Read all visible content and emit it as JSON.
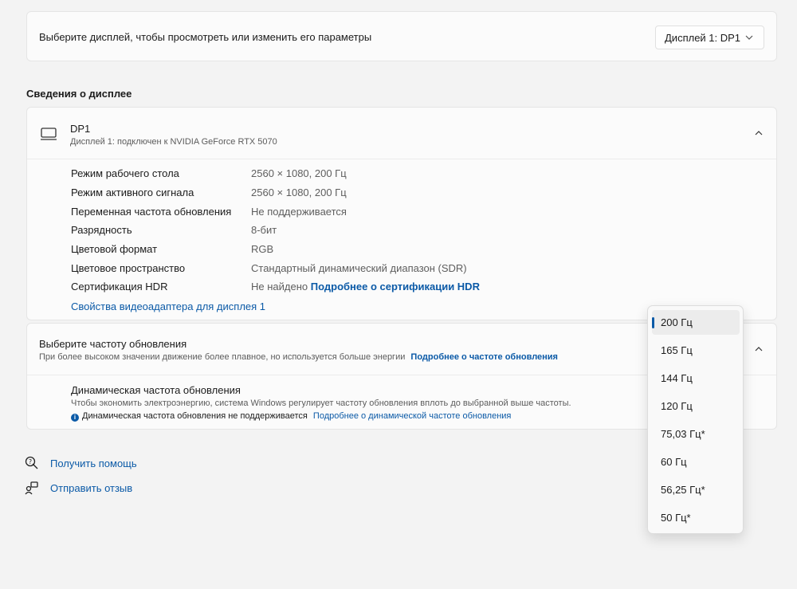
{
  "display_select": {
    "label": "Выберите дисплей, чтобы просмотреть или изменить его параметры",
    "value": "Дисплей 1: DP1"
  },
  "section_title": "Сведения о дисплее",
  "display_info": {
    "name": "DP1",
    "subtitle": "Дисплей 1: подключен к NVIDIA GeForce RTX 5070",
    "properties": [
      {
        "label": "Режим рабочего стола",
        "value": "2560 × 1080, 200 Гц"
      },
      {
        "label": "Режим активного сигнала",
        "value": "2560 × 1080, 200 Гц"
      },
      {
        "label": "Переменная частота обновления",
        "value": "Не поддерживается"
      },
      {
        "label": "Разрядность",
        "value": "8-бит"
      },
      {
        "label": "Цветовой формат",
        "value": "RGB"
      },
      {
        "label": "Цветовое пространство",
        "value": "Стандартный динамический диапазон (SDR)"
      },
      {
        "label": "Сертификация HDR",
        "value": "Не найдено",
        "link": "Подробнее о сертификации HDR"
      }
    ],
    "adapter_link": "Свойства видеоадаптера для дисплея 1"
  },
  "refresh_rate": {
    "title": "Выберите частоту обновления",
    "description": "При более высоком значении движение более плавное, но используется больше энергии",
    "link": "Подробнее о частоте обновления",
    "dynamic": {
      "title": "Динамическая частота обновления",
      "description": "Чтобы экономить электроэнергию, система Windows регулирует частоту обновления вплоть до выбранной выше частоты.",
      "note": "Динамическая частота обновления не поддерживается",
      "note_link": "Подробнее о динамической частоте обновления"
    },
    "options": [
      "200 Гц",
      "165 Гц",
      "144 Гц",
      "120 Гц",
      "75,03 Гц*",
      "60 Гц",
      "56,25 Гц*",
      "50 Гц*"
    ],
    "selected": "200 Гц"
  },
  "footer": {
    "help": "Получить помощь",
    "feedback": "Отправить отзыв"
  }
}
